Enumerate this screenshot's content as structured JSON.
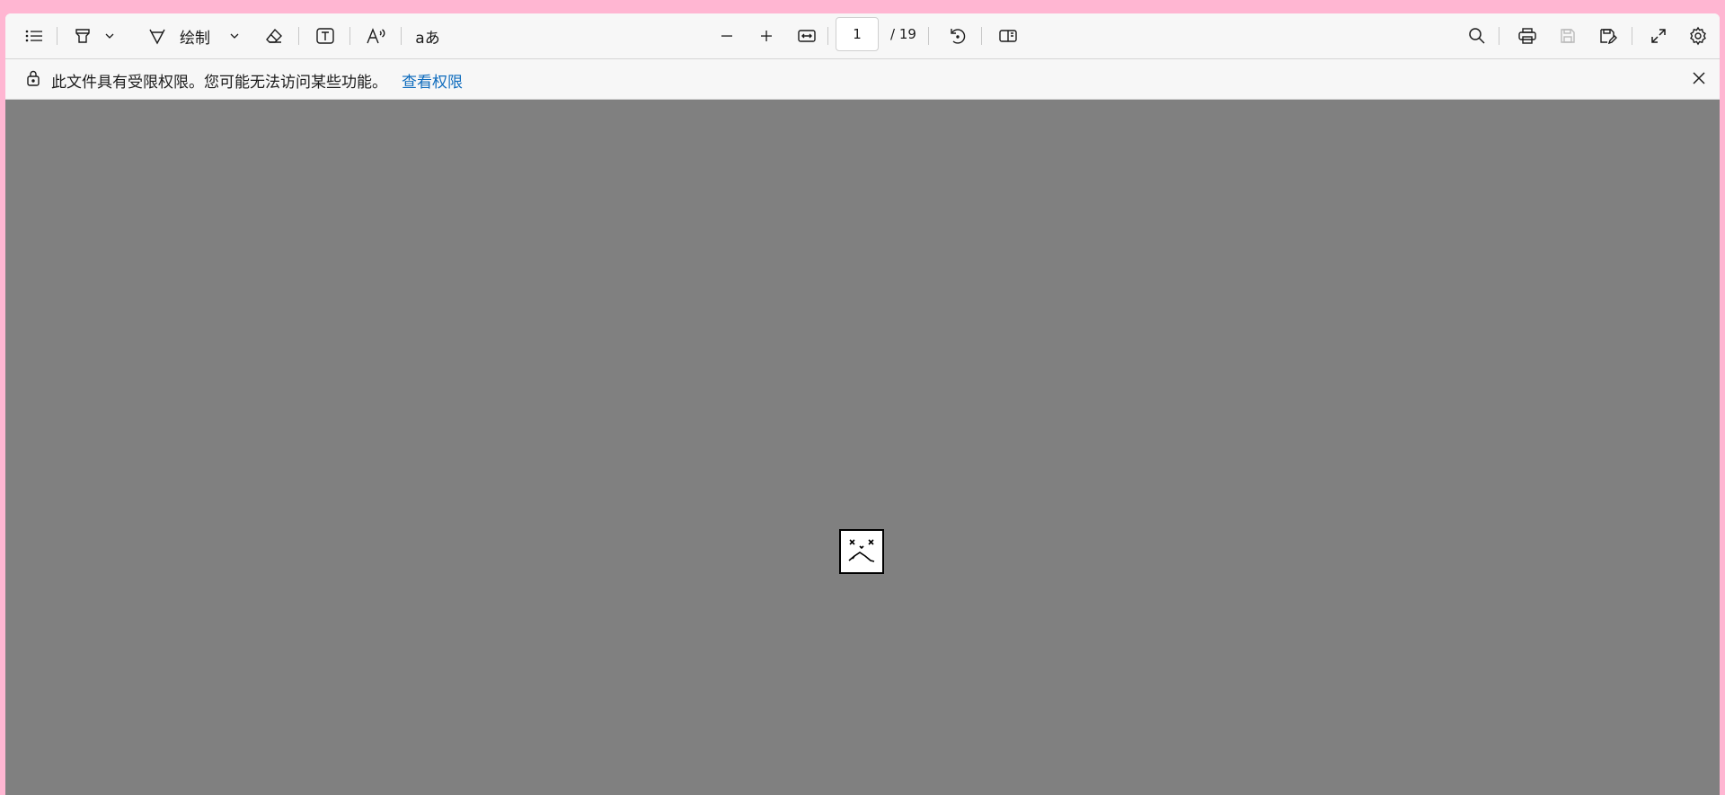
{
  "toolbar": {
    "contents_icon": "list-icon",
    "highlight_icon": "highlighter-icon",
    "draw_label": "绘制",
    "draw_icon": "pen-icon",
    "erase_icon": "eraser-icon",
    "text_icon": "text-box-icon",
    "read_aloud_icon": "read-aloud-icon",
    "translate_label": "aあ",
    "zoom_out_icon": "minus-icon",
    "zoom_in_icon": "plus-icon",
    "fit_icon": "fit-width-icon",
    "page_number": "1",
    "page_total": "/ 19",
    "rotate_icon": "rotate-icon",
    "view_icon": "page-view-icon",
    "search_icon": "search-icon",
    "print_icon": "print-icon",
    "save_icon": "save-icon",
    "save_as_icon": "save-as-icon",
    "fullscreen_icon": "expand-icon",
    "settings_icon": "gear-icon"
  },
  "banner": {
    "message": "此文件具有受限权限。您可能无法访问某些功能。",
    "link": "查看权限",
    "link_color": "#0f6cbd"
  },
  "viewer": {
    "background": "#808080",
    "placeholder_icon": "broken-image-icon"
  },
  "colors": {
    "window_border": "#ffb6d2",
    "toolbar_bg": "#f7f7f7"
  }
}
